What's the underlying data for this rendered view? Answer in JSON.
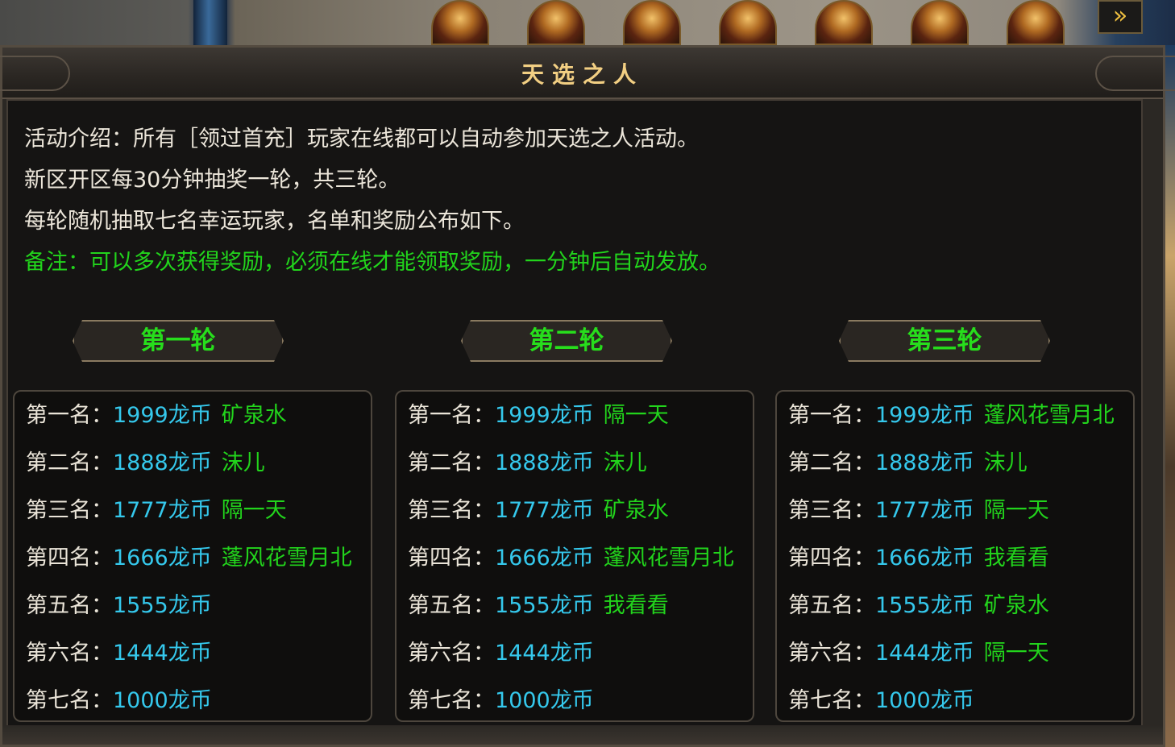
{
  "panel": {
    "title": "天选之人"
  },
  "intro": {
    "line1": "活动介绍：所有［领过首充］玩家在线都可以自动参加天选之人活动。",
    "line2": "新区开区每30分钟抽奖一轮，共三轮。",
    "line3": "每轮随机抽取七名幸运玩家，名单和奖励公布如下。",
    "note": "备注：可以多次获得奖励，必须在线才能领取奖励，一分钟后自动发放。"
  },
  "colors": {
    "title": "#f2cf83",
    "note": "#22d41c",
    "reward": "#35c8ec",
    "player": "#22d41c",
    "rank": "#eae4d8"
  },
  "rounds": [
    {
      "title": "第一轮",
      "rows": [
        {
          "rank": "第一名：",
          "reward": "1999龙币",
          "player": "矿泉水"
        },
        {
          "rank": "第二名：",
          "reward": "1888龙币",
          "player": "沫儿"
        },
        {
          "rank": "第三名：",
          "reward": "1777龙币",
          "player": "隔一天"
        },
        {
          "rank": "第四名：",
          "reward": "1666龙币",
          "player": "蓬风花雪月北"
        },
        {
          "rank": "第五名：",
          "reward": "1555龙币",
          "player": ""
        },
        {
          "rank": "第六名：",
          "reward": "1444龙币",
          "player": ""
        },
        {
          "rank": "第七名：",
          "reward": "1000龙币",
          "player": ""
        }
      ]
    },
    {
      "title": "第二轮",
      "rows": [
        {
          "rank": "第一名：",
          "reward": "1999龙币",
          "player": "隔一天"
        },
        {
          "rank": "第二名：",
          "reward": "1888龙币",
          "player": "沫儿"
        },
        {
          "rank": "第三名：",
          "reward": "1777龙币",
          "player": "矿泉水"
        },
        {
          "rank": "第四名：",
          "reward": "1666龙币",
          "player": "蓬风花雪月北"
        },
        {
          "rank": "第五名：",
          "reward": "1555龙币",
          "player": "我看看"
        },
        {
          "rank": "第六名：",
          "reward": "1444龙币",
          "player": ""
        },
        {
          "rank": "第七名：",
          "reward": "1000龙币",
          "player": ""
        }
      ]
    },
    {
      "title": "第三轮",
      "rows": [
        {
          "rank": "第一名：",
          "reward": "1999龙币",
          "player": "蓬风花雪月北"
        },
        {
          "rank": "第二名：",
          "reward": "1888龙币",
          "player": "沫儿"
        },
        {
          "rank": "第三名：",
          "reward": "1777龙币",
          "player": "隔一天"
        },
        {
          "rank": "第四名：",
          "reward": "1666龙币",
          "player": "我看看"
        },
        {
          "rank": "第五名：",
          "reward": "1555龙币",
          "player": "矿泉水"
        },
        {
          "rank": "第六名：",
          "reward": "1444龙币",
          "player": "隔一天"
        },
        {
          "rank": "第七名：",
          "reward": "1000龙币",
          "player": ""
        }
      ]
    }
  ]
}
